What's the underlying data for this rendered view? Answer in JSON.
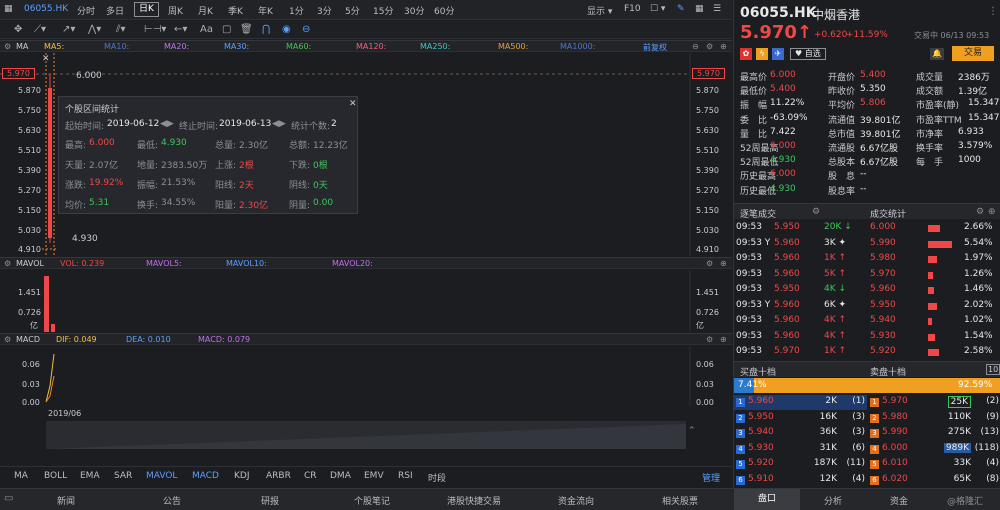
{
  "toolbar": {
    "code": "06055.HK",
    "periods": [
      "分时",
      "多日",
      "日K",
      "周K",
      "月K",
      "季K",
      "年K",
      "1分",
      "3分",
      "5分",
      "15分",
      "30分",
      "60分"
    ],
    "active_period": "日K",
    "display_label": "显示",
    "f10_label": "F10"
  },
  "drawbar": {
    "font_label": "Aa"
  },
  "main_chart": {
    "head": {
      "name": "MA",
      "items": [
        {
          "label": "MA5:",
          "color": "#f0c040"
        },
        {
          "label": "MA10:",
          "color": "#4a78c8"
        },
        {
          "label": "MA20:",
          "color": "#c070f0"
        },
        {
          "label": "MA30:",
          "color": "#5aa0ff"
        },
        {
          "label": "MA60:",
          "color": "#3ec65a"
        },
        {
          "label": "MA120:",
          "color": "#f06080"
        },
        {
          "label": "MA250:",
          "color": "#3ec6c6"
        },
        {
          "label": "MA500:",
          "color": "#e0a040"
        },
        {
          "label": "MA1000:",
          "color": "#4a78c8"
        }
      ],
      "adjust_label": "前复权"
    },
    "y_ticks_left": [
      "5.870",
      "5.750",
      "5.630",
      "5.510",
      "5.390",
      "5.270",
      "5.150",
      "5.030",
      "4.910"
    ],
    "y_ticks_right": [
      "5.870",
      "5.750",
      "5.630",
      "5.510",
      "5.390",
      "5.270",
      "5.150",
      "5.030",
      "4.910"
    ],
    "current_price_flag": "5.970",
    "high_label": "6.000",
    "low_label": "4.930"
  },
  "stats_popup": {
    "title": "个股区间统计",
    "start_label": "起始时间:",
    "start_value": "2019-06-12",
    "end_label": "终止时间:",
    "end_value": "2019-06-13",
    "count_label": "统计个数:",
    "count_value": "2",
    "rows": [
      [
        {
          "k": "最高:",
          "v": "6.000",
          "c": "red"
        },
        {
          "k": "最低:",
          "v": "4.930",
          "c": "green"
        },
        {
          "k": "总量:",
          "v": "2.30亿",
          "c": "gray"
        },
        {
          "k": "总额:",
          "v": "12.23亿",
          "c": "gray"
        }
      ],
      [
        {
          "k": "天量:",
          "v": "2.07亿",
          "c": "gray"
        },
        {
          "k": "地量:",
          "v": "2383.50万",
          "c": "gray"
        },
        {
          "k": "上涨:",
          "v": "2根",
          "c": "red"
        },
        {
          "k": "下跌:",
          "v": "0根",
          "c": "green"
        }
      ],
      [
        {
          "k": "涨跌:",
          "v": "19.92%",
          "c": "red"
        },
        {
          "k": "振幅:",
          "v": "21.53%",
          "c": "gray"
        },
        {
          "k": "阳线:",
          "v": "2天",
          "c": "red"
        },
        {
          "k": "阴线:",
          "v": "0天",
          "c": "green"
        }
      ],
      [
        {
          "k": "均价:",
          "v": "5.31",
          "c": "green"
        },
        {
          "k": "换手:",
          "v": "34.55%",
          "c": "gray"
        },
        {
          "k": "阳量:",
          "v": "2.30亿",
          "c": "red"
        },
        {
          "k": "阴量:",
          "v": "0.00",
          "c": "green"
        }
      ]
    ]
  },
  "volume_chart": {
    "head": [
      {
        "label": "MAVOL",
        "color": "#c9ccd2"
      },
      {
        "label": "VOL: 0.239",
        "color": "#f04848"
      },
      {
        "label": "MAVOL5:",
        "color": "#c070f0"
      },
      {
        "label": "MAVOL10:",
        "color": "#5aa0ff"
      },
      {
        "label": "MAVOL20:",
        "color": "#c070f0"
      }
    ],
    "y_ticks": [
      "1.451",
      "0.726"
    ],
    "unit": "亿"
  },
  "macd_chart": {
    "head": [
      {
        "label": "MACD",
        "color": "#c9ccd2"
      },
      {
        "label": "DIF: 0.049",
        "color": "#f0c040"
      },
      {
        "label": "DEA: 0.010",
        "color": "#5aa0ff"
      },
      {
        "label": "MACD: 0.079",
        "color": "#c070f0"
      }
    ],
    "y_ticks": [
      "0.06",
      "0.03",
      "0.00"
    ],
    "x_label": "2019/06"
  },
  "indicator_tabs": {
    "items": [
      "MA",
      "BOLL",
      "EMA",
      "SAR",
      "MAVOL",
      "MACD",
      "KDJ",
      "ARBR",
      "CR",
      "DMA",
      "EMV",
      "RSI",
      "时段"
    ],
    "manage_label": "管理"
  },
  "bottom_nav": {
    "items": [
      "新闻",
      "公告",
      "研报",
      "个股笔记",
      "港股快捷交易",
      "资金流向",
      "相关股票",
      "盘口",
      "分析",
      "资金"
    ],
    "active": "盘口",
    "watermark": "@格隆汇"
  },
  "quote": {
    "code": "06055.HK",
    "name": "中烟香港",
    "price": "5.970",
    "change": "+0.620",
    "change_pct": "+11.59%",
    "status": "交易中 06/13 09:53",
    "watchlist_label": "自选",
    "trade_label": "交易",
    "fields": [
      [
        {
          "k": "最高价",
          "v": "6.000",
          "c": "red"
        },
        {
          "k": "开盘价",
          "v": "5.400",
          "c": "red"
        },
        {
          "k": "成交量",
          "v": "2386万",
          "c": "white"
        }
      ],
      [
        {
          "k": "最低价",
          "v": "5.400",
          "c": "red"
        },
        {
          "k": "昨收价",
          "v": "5.350",
          "c": "white"
        },
        {
          "k": "成交额",
          "v": "1.39亿",
          "c": "white"
        }
      ],
      [
        {
          "k": "振　幅",
          "v": "11.22%",
          "c": "white"
        },
        {
          "k": "平均价",
          "v": "5.806",
          "c": "red"
        },
        {
          "k": "市盈率(静)",
          "v": "15.347",
          "c": "white"
        }
      ],
      [
        {
          "k": "委　比",
          "v": "-63.09%",
          "c": "white"
        },
        {
          "k": "流通值",
          "v": "39.801亿",
          "c": "white"
        },
        {
          "k": "市盈率TTM",
          "v": "15.347",
          "c": "white"
        }
      ],
      [
        {
          "k": "量　比",
          "v": "7.422",
          "c": "white"
        },
        {
          "k": "总市值",
          "v": "39.801亿",
          "c": "white"
        },
        {
          "k": "市净率",
          "v": "6.933",
          "c": "white"
        }
      ],
      [
        {
          "k": "52周最高",
          "v": "6.000",
          "c": "red"
        },
        {
          "k": "流通股",
          "v": "6.67亿股",
          "c": "white"
        },
        {
          "k": "换手率",
          "v": "3.579%",
          "c": "white"
        }
      ],
      [
        {
          "k": "52周最低",
          "v": "4.930",
          "c": "green"
        },
        {
          "k": "总股本",
          "v": "6.67亿股",
          "c": "white"
        },
        {
          "k": "每　手",
          "v": "1000",
          "c": "white"
        }
      ],
      [
        {
          "k": "历史最高",
          "v": "6.000",
          "c": "red"
        },
        {
          "k": "股　息",
          "v": "--",
          "c": "white"
        },
        {
          "k": "",
          "v": "",
          "c": "white"
        }
      ],
      [
        {
          "k": "历史最低",
          "v": "4.930",
          "c": "green"
        },
        {
          "k": "股息率",
          "v": "--",
          "c": "white"
        },
        {
          "k": "",
          "v": "",
          "c": "white"
        }
      ]
    ],
    "trades_title": "逐笔成交",
    "stats_title": "成交统计",
    "trades": [
      {
        "time": "09:53",
        "price": "5.950",
        "vol": "20K",
        "arrow": "↓",
        "c": "green"
      },
      {
        "time": "09:53 Y",
        "price": "5.960",
        "vol": "3K",
        "arrow": "✦",
        "c": "white"
      },
      {
        "time": "09:53",
        "price": "5.960",
        "vol": "1K",
        "arrow": "↑",
        "c": "red"
      },
      {
        "time": "09:53",
        "price": "5.960",
        "vol": "5K",
        "arrow": "↑",
        "c": "red"
      },
      {
        "time": "09:53",
        "price": "5.950",
        "vol": "4K",
        "arrow": "↓",
        "c": "green"
      },
      {
        "time": "09:53 Y",
        "price": "5.960",
        "vol": "6K",
        "arrow": "✦",
        "c": "white"
      },
      {
        "time": "09:53",
        "price": "5.960",
        "vol": "4K",
        "arrow": "↑",
        "c": "red"
      },
      {
        "time": "09:53",
        "price": "5.960",
        "vol": "4K",
        "arrow": "↑",
        "c": "red"
      },
      {
        "time": "09:53",
        "price": "5.970",
        "vol": "1K",
        "arrow": "↑",
        "c": "red"
      }
    ],
    "trade_stats": [
      {
        "price": "6.000",
        "pct": "2.66%",
        "share": 0.0266
      },
      {
        "price": "5.990",
        "pct": "5.54%",
        "share": 0.0554
      },
      {
        "price": "5.980",
        "pct": "1.97%",
        "share": 0.0197
      },
      {
        "price": "5.970",
        "pct": "1.26%",
        "share": 0.0126
      },
      {
        "price": "5.960",
        "pct": "1.46%",
        "share": 0.0146
      },
      {
        "price": "5.950",
        "pct": "2.02%",
        "share": 0.0202
      },
      {
        "price": "5.940",
        "pct": "1.02%",
        "share": 0.0102
      },
      {
        "price": "5.930",
        "pct": "1.54%",
        "share": 0.0154
      },
      {
        "price": "5.920",
        "pct": "2.58%",
        "share": 0.0258
      }
    ],
    "book_bid_title": "买盘十档",
    "book_ask_title": "卖盘十档",
    "book_badge": "10",
    "bid_ratio": "7.41%",
    "ask_ratio": "92.59%",
    "bid_share": 0.0741,
    "bids": [
      {
        "n": "1",
        "price": "5.960",
        "vol": "2K",
        "cnt": "1"
      },
      {
        "n": "2",
        "price": "5.950",
        "vol": "16K",
        "cnt": "3"
      },
      {
        "n": "3",
        "price": "5.940",
        "vol": "36K",
        "cnt": "3"
      },
      {
        "n": "4",
        "price": "5.930",
        "vol": "31K",
        "cnt": "6"
      },
      {
        "n": "5",
        "price": "5.920",
        "vol": "187K",
        "cnt": "11"
      },
      {
        "n": "6",
        "price": "5.910",
        "vol": "12K",
        "cnt": "4"
      }
    ],
    "asks": [
      {
        "n": "1",
        "price": "5.970",
        "vol": "25K",
        "cnt": "2"
      },
      {
        "n": "2",
        "price": "5.980",
        "vol": "110K",
        "cnt": "9"
      },
      {
        "n": "3",
        "price": "5.990",
        "vol": "275K",
        "cnt": "13"
      },
      {
        "n": "4",
        "price": "6.000",
        "vol": "989K",
        "cnt": "118"
      },
      {
        "n": "5",
        "price": "6.010",
        "vol": "33K",
        "cnt": "4"
      },
      {
        "n": "6",
        "price": "6.020",
        "vol": "65K",
        "cnt": "8"
      }
    ]
  }
}
